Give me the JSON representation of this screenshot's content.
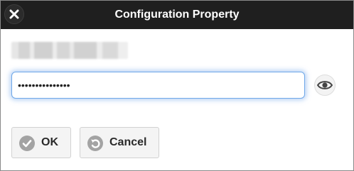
{
  "dialog": {
    "title": "Configuration Property",
    "close_icon": "close-icon",
    "field_label": "",
    "password": {
      "value": "•••••••••••••••",
      "masked": true
    },
    "reveal_icon": "eye-icon",
    "buttons": {
      "ok": {
        "label": "OK",
        "icon": "checkmark-icon"
      },
      "cancel": {
        "label": "Cancel",
        "icon": "undo-icon"
      }
    }
  },
  "colors": {
    "titlebar_bg": "#1f1f1f",
    "title_text": "#ffffff",
    "focus_ring": "#6fa8e8",
    "button_bg": "#f4f4f4",
    "button_icon_bg": "#a3a3a3"
  }
}
